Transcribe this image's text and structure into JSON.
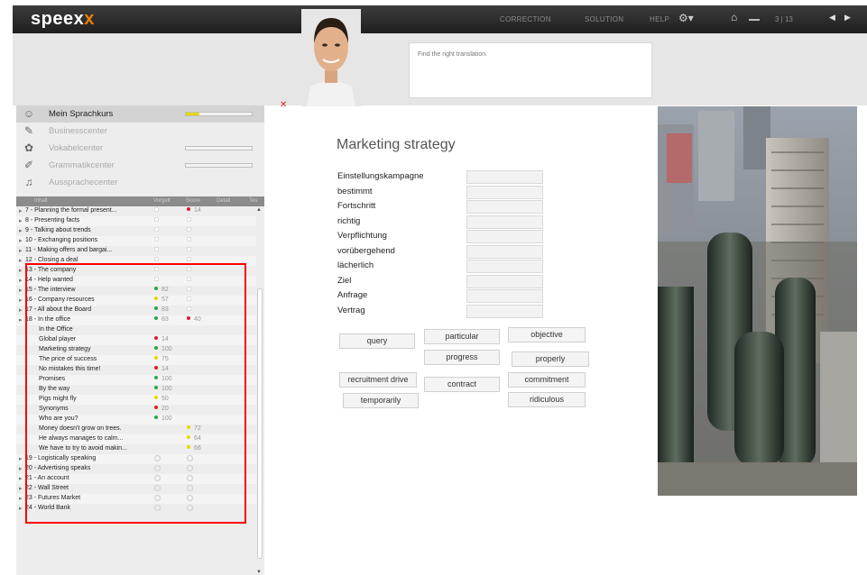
{
  "topbar": {
    "logo_main": "speex",
    "logo_accent": "x",
    "nav_correction": "CORRECTION",
    "nav_solution": "SOLUTION",
    "nav_help": "HELP",
    "page_counter": "3 | 13"
  },
  "instruction": "Find the right translation.",
  "menu": [
    {
      "label": "Mein Sprachkurs",
      "icon": "user-icon",
      "active": true,
      "progress": 0.2
    },
    {
      "label": "Businesscenter",
      "icon": "briefcase-icon",
      "active": false
    },
    {
      "label": "Vokabelcenter",
      "icon": "words-icon",
      "active": false,
      "progress": 0
    },
    {
      "label": "Grammatikcenter",
      "icon": "pen-icon",
      "active": false,
      "progress": 0
    },
    {
      "label": "Aussprachecenter",
      "icon": "speaker-icon",
      "active": false
    }
  ],
  "columns": [
    "Inhalt",
    "Vorgelt",
    "Score",
    "Detail",
    "Tes"
  ],
  "lessons": [
    {
      "label": "7 - Planning the formal present...",
      "indent": 0,
      "s1": "",
      "s2": "14"
    },
    {
      "label": "8 - Presenting facts",
      "indent": 0,
      "s1": "",
      "s2": ""
    },
    {
      "label": "9 - Talking about trends",
      "indent": 0,
      "s1": "",
      "s2": ""
    },
    {
      "label": "10 - Exchanging positions",
      "indent": 0,
      "s1": "",
      "s2": ""
    },
    {
      "label": "11 - Making offers and bargai...",
      "indent": 0,
      "s1": "",
      "s2": ""
    },
    {
      "label": "12 - Closing a deal",
      "indent": 0,
      "s1": "",
      "s2": ""
    },
    {
      "label": "13 - The company",
      "indent": 0,
      "s1": "",
      "s2": ""
    },
    {
      "label": "14 - Help wanted",
      "indent": 0,
      "s1": "",
      "s2": ""
    },
    {
      "label": "15 - The interview",
      "indent": 0,
      "s1": "82",
      "s2": ""
    },
    {
      "label": "16 - Company resources",
      "indent": 0,
      "s1": "57",
      "s2": ""
    },
    {
      "label": "17 - All about the Board",
      "indent": 0,
      "s1": "83",
      "s2": ""
    },
    {
      "label": "18 - In the office",
      "indent": 0,
      "s1": "83",
      "s2": "40"
    },
    {
      "label": "In the Office",
      "indent": 1,
      "s1": "",
      "s2": ""
    },
    {
      "label": "Global player",
      "indent": 1,
      "s1": "14",
      "s2": ""
    },
    {
      "label": "Marketing strategy",
      "indent": 1,
      "s1": "100",
      "s2": ""
    },
    {
      "label": "The price of success",
      "indent": 1,
      "s1": "75",
      "s2": ""
    },
    {
      "label": "No mistakes this time!",
      "indent": 1,
      "s1": "14",
      "s2": ""
    },
    {
      "label": "Promises",
      "indent": 1,
      "s1": "100",
      "s2": ""
    },
    {
      "label": "By the way",
      "indent": 1,
      "s1": "100",
      "s2": ""
    },
    {
      "label": "Pigs might fly",
      "indent": 1,
      "s1": "50",
      "s2": ""
    },
    {
      "label": "Synonyms",
      "indent": 1,
      "s1": "20",
      "s2": ""
    },
    {
      "label": "Who are you?",
      "indent": 1,
      "s1": "100",
      "s2": ""
    },
    {
      "label": "Money doesn't grow on trees.",
      "indent": 1,
      "s1": "",
      "s2": "72"
    },
    {
      "label": "He always manages to calm...",
      "indent": 1,
      "s1": "",
      "s2": "64"
    },
    {
      "label": "We have to try to avoid makin...",
      "indent": 1,
      "s1": "",
      "s2": "66"
    },
    {
      "label": "19 - Logistically speaking",
      "indent": 0,
      "s1": "",
      "s2": ""
    },
    {
      "label": "20 - Advertising speaks",
      "indent": 0,
      "s1": "",
      "s2": ""
    },
    {
      "label": "21 - An account",
      "indent": 0,
      "s1": "",
      "s2": ""
    },
    {
      "label": "22 - Wall Street",
      "indent": 0,
      "s1": "",
      "s2": ""
    },
    {
      "label": "23 - Futures Market",
      "indent": 0,
      "s1": "",
      "s2": ""
    },
    {
      "label": "24 - World Bank",
      "indent": 0,
      "s1": "",
      "s2": ""
    }
  ],
  "exercise": {
    "title": "Marketing strategy",
    "words": [
      "Einstellungskampagne",
      "bestimmt",
      "Fortschritt",
      "richtig",
      "Verpflichtung",
      "vorübergehend",
      "lächerlich",
      "Ziel",
      "Anfrage",
      "Vertrag"
    ],
    "chips": [
      "query",
      "particular",
      "objective",
      "progress",
      "properly",
      "recruitment drive",
      "contract",
      "commitment",
      "temporarily",
      "ridiculous"
    ]
  },
  "colors": {
    "accent": "#f07d00",
    "highlight": "#ff0000",
    "green": "#2aa84a",
    "red": "#d92020",
    "yellow": "#e8d800"
  }
}
